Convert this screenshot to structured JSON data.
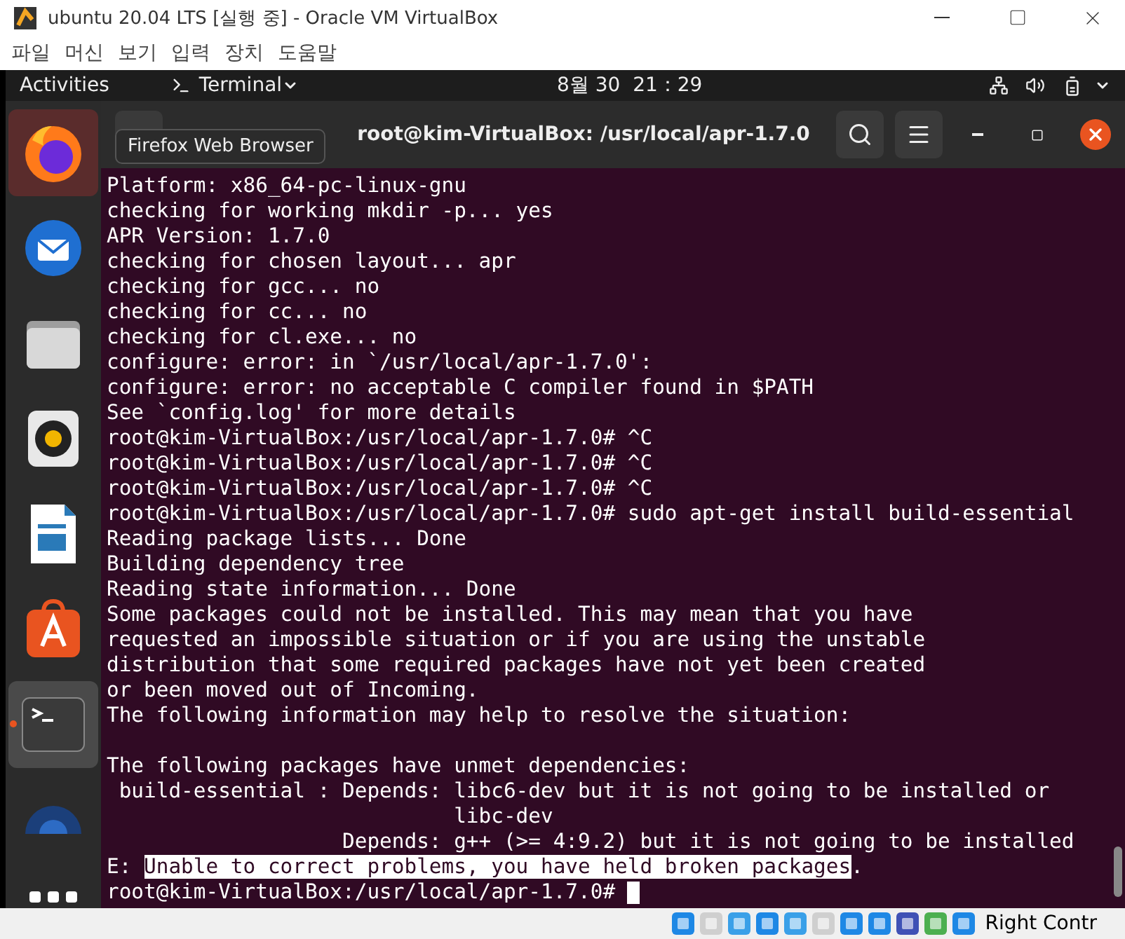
{
  "window": {
    "title": "ubuntu 20.04 LTS [실행 중] - Oracle VM VirtualBox"
  },
  "menu": [
    "파일",
    "머신",
    "보기",
    "입력",
    "장치",
    "도움말"
  ],
  "top_bar": {
    "activities": "Activities",
    "app": "Terminal",
    "clock": "8월 30  21：29"
  },
  "dock": {
    "items": [
      {
        "kind": "firefox",
        "selected": true
      },
      {
        "kind": "mail",
        "selected": false
      },
      {
        "kind": "files",
        "selected": false
      },
      {
        "kind": "music",
        "selected": false
      },
      {
        "kind": "writer",
        "selected": false
      },
      {
        "kind": "software",
        "selected": false
      },
      {
        "kind": "terminal",
        "selected": true,
        "running": true
      },
      {
        "kind": "help",
        "selected": false
      },
      {
        "kind": "apps",
        "selected": false
      }
    ],
    "tooltip": "Firefox Web Browser"
  },
  "terminal": {
    "title": "root@kim-VirtualBox: /usr/local/apr-1.7.0",
    "lines": [
      {
        "kind": "text",
        "text": "Platform: x86_64-pc-linux-gnu"
      },
      {
        "kind": "text",
        "text": "checking for working mkdir -p... yes"
      },
      {
        "kind": "text",
        "text": "APR Version: 1.7.0"
      },
      {
        "kind": "text",
        "text": "checking for chosen layout... apr"
      },
      {
        "kind": "text",
        "text": "checking for gcc... no"
      },
      {
        "kind": "text",
        "text": "checking for cc... no"
      },
      {
        "kind": "text",
        "text": "checking for cl.exe... no"
      },
      {
        "kind": "text",
        "text": "configure: error: in `/usr/local/apr-1.7.0':"
      },
      {
        "kind": "text",
        "text": "configure: error: no acceptable C compiler found in $PATH"
      },
      {
        "kind": "text",
        "text": "See `config.log' for more details"
      },
      {
        "kind": "text",
        "text": "root@kim-VirtualBox:/usr/local/apr-1.7.0# ^C"
      },
      {
        "kind": "text",
        "text": "root@kim-VirtualBox:/usr/local/apr-1.7.0# ^C"
      },
      {
        "kind": "text",
        "text": "root@kim-VirtualBox:/usr/local/apr-1.7.0# ^C"
      },
      {
        "kind": "text",
        "text": "root@kim-VirtualBox:/usr/local/apr-1.7.0# sudo apt-get install build-essential"
      },
      {
        "kind": "text",
        "text": "Reading package lists... Done"
      },
      {
        "kind": "text",
        "text": "Building dependency tree"
      },
      {
        "kind": "text",
        "text": "Reading state information... Done"
      },
      {
        "kind": "text",
        "text": "Some packages could not be installed. This may mean that you have"
      },
      {
        "kind": "text",
        "text": "requested an impossible situation or if you are using the unstable"
      },
      {
        "kind": "text",
        "text": "distribution that some required packages have not yet been created"
      },
      {
        "kind": "text",
        "text": "or been moved out of Incoming."
      },
      {
        "kind": "text",
        "text": "The following information may help to resolve the situation:"
      },
      {
        "kind": "blank"
      },
      {
        "kind": "text",
        "text": "The following packages have unmet dependencies:"
      },
      {
        "kind": "text",
        "text": " build-essential : Depends: libc6-dev but it is not going to be installed or"
      },
      {
        "kind": "text",
        "text": "                            libc-dev"
      },
      {
        "kind": "text",
        "text": "                   Depends: g++ (>= 4:9.2) but it is not going to be installed"
      },
      {
        "kind": "selection",
        "before": "E: ",
        "selected": "Unable to correct problems, you have held broken packages",
        "after": "."
      },
      {
        "kind": "prompt",
        "text": "root@kim-VirtualBox:/usr/local/apr-1.7.0# "
      }
    ]
  },
  "status_bar": {
    "host_key": "Right Contr"
  }
}
